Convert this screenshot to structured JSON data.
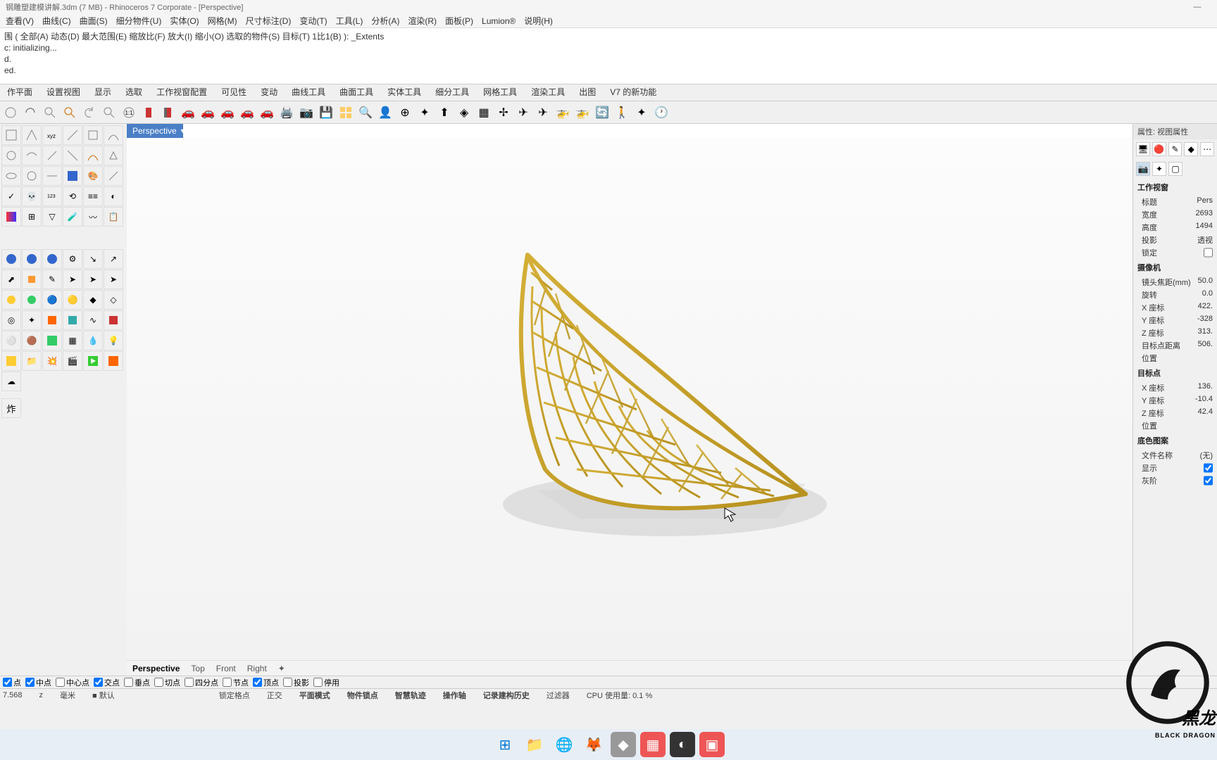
{
  "title": "钢雕塑建模讲解.3dm (7 MB) - Rhinoceros 7 Corporate - [Perspective]",
  "menu": [
    "查看(V)",
    "曲线(C)",
    "曲面(S)",
    "细分物件(U)",
    "实体(O)",
    "网格(M)",
    "尺寸标注(D)",
    "变动(T)",
    "工具(L)",
    "分析(A)",
    "渲染(R)",
    "面板(P)",
    "Lumion®",
    "说明(H)"
  ],
  "cmd": {
    "l1": "围 ( 全部(A) 动态(D) 最大范围(E) 缩放比(F) 放大(I) 缩小(O) 选取的物件(S) 目标(T) 1比1(B) ): _Extents",
    "l2": "c: initializing...",
    "l3": "d.",
    "l4": "ed."
  },
  "tabs": [
    "作平面",
    "设置视图",
    "显示",
    "选取",
    "工作视窗配置",
    "可见性",
    "变动",
    "曲线工具",
    "曲面工具",
    "实体工具",
    "细分工具",
    "网格工具",
    "渲染工具",
    "出图",
    "V7 的新功能"
  ],
  "viewport_label": "Perspective",
  "props_header": "属性: 视图属性",
  "props": {
    "sec1": "工作视窗",
    "title_k": "标题",
    "title_v": "Pers",
    "width_k": "宽度",
    "width_v": "2693",
    "height_k": "高度",
    "height_v": "1494",
    "proj_k": "投影",
    "proj_v": "透视",
    "lock_k": "锁定",
    "sec2": "摄像机",
    "focal_k": "镜头焦距(mm)",
    "focal_v": "50.0",
    "rot_k": "旋转",
    "rot_v": "0.0",
    "x_k": "X 座标",
    "x_v": "422.",
    "y_k": "Y 座标",
    "y_v": "-328",
    "z_k": "Z 座标",
    "z_v": "313.",
    "dist_k": "目标点距离",
    "dist_v": "506.",
    "pos_k": "位置",
    "sec3": "目标点",
    "tx_k": "X 座标",
    "tx_v": "136.",
    "ty_k": "Y 座标",
    "ty_v": "-10.4",
    "tz_k": "Z 座标",
    "tz_v": "42.4",
    "tpos_k": "位置",
    "sec4": "底色图案",
    "file_k": "文件名称",
    "file_v": "(无)",
    "show_k": "显示",
    "gray_k": "灰阶"
  },
  "vtabs": [
    "Perspective",
    "Top",
    "Front",
    "Right"
  ],
  "osnap": {
    "end": "点",
    "mid": "中点",
    "cen": "中心点",
    "int": "交点",
    "perp": "垂点",
    "tan": "切点",
    "quad": "四分点",
    "knot": "节点",
    "vert": "顶点",
    "proj": "投影",
    "dis": "停用"
  },
  "status": {
    "coord": "7.568",
    "z": "z",
    "unit": "毫米",
    "layer": "默认",
    "s1": "锁定格点",
    "s2": "正交",
    "s3": "平面模式",
    "s4": "物件锁点",
    "s5": "智慧轨迹",
    "s6": "操作轴",
    "s7": "记录建构历史",
    "s8": "过滤器",
    "s9": "CPU 使用量: 0.1 %"
  },
  "logo": {
    "main": "黑龙",
    "sub": "BLACK DRAGON"
  }
}
